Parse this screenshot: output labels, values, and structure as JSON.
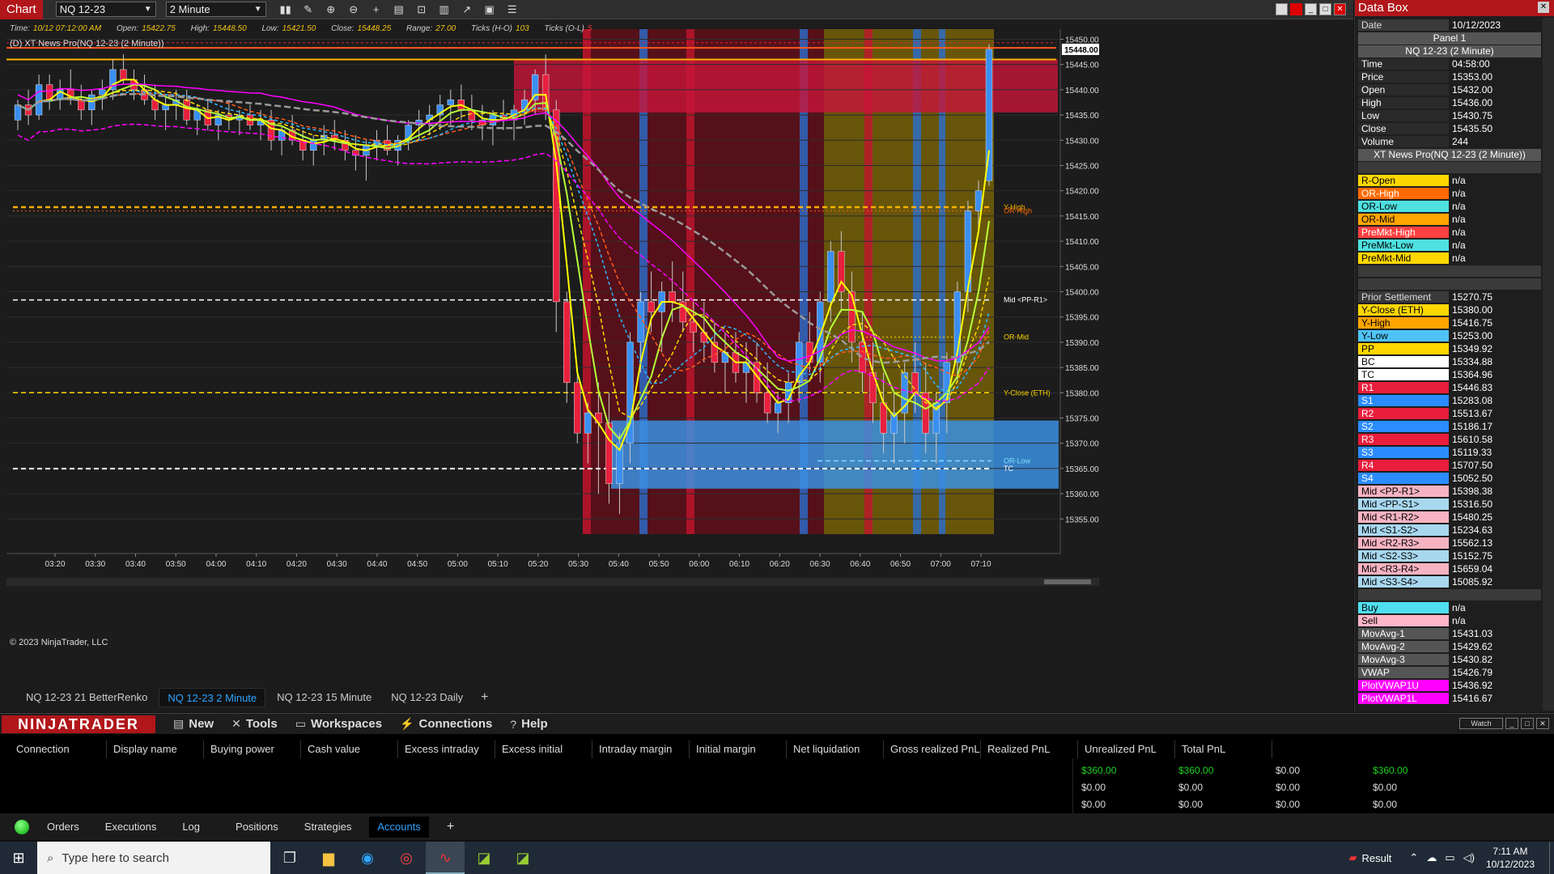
{
  "toolbar": {
    "title": "Chart",
    "instrument": "NQ 12-23",
    "interval": "2 Minute"
  },
  "info": {
    "time_label": "Time:",
    "time": "10/12 07:12:00 AM",
    "open_label": "Open:",
    "open": "15422.75",
    "high_label": "High:",
    "high": "15448.50",
    "low_label": "Low:",
    "low": "15421.50",
    "close_label": "Close:",
    "close": "15448.25",
    "range_label": "Range:",
    "range": "27.00",
    "ticks_ho_label": "Ticks (H-O)",
    "ticks_ho": "103",
    "ticks_ol_label": "Ticks (O-L)",
    "ticks_ol": "5"
  },
  "indicator_label": "(D) XT News Pro(NQ 12-23 (2 Minute))",
  "copyright": "© 2023 NinjaTrader, LLC",
  "chart_data": {
    "type": "candlestick",
    "instrument": "NQ 12-23",
    "interval": "2 Minute",
    "last_price": "15448.00",
    "ylim": [
      15352,
      15452
    ],
    "y_ticks": [
      15355,
      15360,
      15365,
      15370,
      15375,
      15380,
      15385,
      15390,
      15395,
      15400,
      15405,
      15410,
      15415,
      15420,
      15425,
      15430,
      15435,
      15440,
      15445,
      15450
    ],
    "y_tick_labels": [
      "15355.00",
      "15360.00",
      "15365.00",
      "15370.00",
      "15375.00",
      "15380.00",
      "15385.00",
      "15390.00",
      "15395.00",
      "15400.00",
      "15405.00",
      "15410.00",
      "15415.00",
      "15420.00",
      "15425.00",
      "15430.00",
      "15435.00",
      "15440.00",
      "15445.00",
      "15450.00"
    ],
    "x_tick_labels": [
      "03:20",
      "03:30",
      "03:40",
      "03:50",
      "04:00",
      "04:10",
      "04:20",
      "04:30",
      "04:40",
      "04:50",
      "05:00",
      "05:10",
      "05:20",
      "05:30",
      "05:40",
      "05:50",
      "06:00",
      "06:10",
      "06:20",
      "06:30",
      "06:40",
      "06:50",
      "07:00",
      "07:10"
    ],
    "level_lines": [
      {
        "name": "Y-High",
        "value": 15416.75,
        "color": "#ffb000"
      },
      {
        "name": "OR-High",
        "value": 15416.0,
        "color": "#ff6a00"
      },
      {
        "name": "Mid <PP-R1>",
        "value": 15398.38,
        "color": "#ffffff"
      },
      {
        "name": "OR-Mid",
        "value": 15391.0,
        "color": "#ffd700"
      },
      {
        "name": "Y-Close (ETH)",
        "value": 15380.0,
        "color": "#ffd700"
      },
      {
        "name": "OR-Low",
        "value": 15366.5,
        "color": "#7ee0ff"
      },
      {
        "name": "TC",
        "value": 15364.96,
        "color": "#ffffff"
      }
    ],
    "candles": [
      [
        15434,
        15438,
        15432,
        15437
      ],
      [
        15437,
        15440,
        15433,
        15435
      ],
      [
        15435,
        15443,
        15434,
        15441
      ],
      [
        15441,
        15443,
        15436,
        15438
      ],
      [
        15438,
        15442,
        15436,
        15440
      ],
      [
        15440,
        15444,
        15437,
        15438
      ],
      [
        15438,
        15441,
        15434,
        15436
      ],
      [
        15436,
        15440,
        15433,
        15439
      ],
      [
        15439,
        15442,
        15436,
        15440
      ],
      [
        15440,
        15446,
        15438,
        15444
      ],
      [
        15444,
        15447,
        15441,
        15442
      ],
      [
        15442,
        15444,
        15438,
        15440
      ],
      [
        15440,
        15443,
        15437,
        15438
      ],
      [
        15438,
        15441,
        15434,
        15436
      ],
      [
        15436,
        15439,
        15432,
        15437
      ],
      [
        15437,
        15440,
        15434,
        15438
      ],
      [
        15438,
        15440,
        15433,
        15434
      ],
      [
        15434,
        15437,
        15431,
        15436
      ],
      [
        15436,
        15438,
        15432,
        15433
      ],
      [
        15433,
        15436,
        15430,
        15435
      ],
      [
        15435,
        15438,
        15432,
        15434
      ],
      [
        15434,
        15436,
        15431,
        15435
      ],
      [
        15435,
        15437,
        15432,
        15433
      ],
      [
        15433,
        15436,
        15430,
        15434
      ],
      [
        15434,
        15436,
        15428,
        15430
      ],
      [
        15430,
        15433,
        15427,
        15432
      ],
      [
        15432,
        15435,
        15429,
        15430
      ],
      [
        15430,
        15432,
        15426,
        15428
      ],
      [
        15428,
        15431,
        15425,
        15430
      ],
      [
        15430,
        15433,
        15427,
        15431
      ],
      [
        15431,
        15434,
        15428,
        15430
      ],
      [
        15430,
        15432,
        15426,
        15428
      ],
      [
        15428,
        15431,
        15424,
        15427
      ],
      [
        15427,
        15430,
        15422,
        15429
      ],
      [
        15429,
        15432,
        15426,
        15430
      ],
      [
        15430,
        15433,
        15427,
        15428
      ],
      [
        15428,
        15431,
        15425,
        15430
      ],
      [
        15430,
        15434,
        15428,
        15433
      ],
      [
        15433,
        15436,
        15430,
        15434
      ],
      [
        15434,
        15437,
        15431,
        15435
      ],
      [
        15435,
        15439,
        15432,
        15437
      ],
      [
        15437,
        15440,
        15433,
        15438
      ],
      [
        15438,
        15441,
        15434,
        15436
      ],
      [
        15436,
        15439,
        15432,
        15434
      ],
      [
        15434,
        15437,
        15430,
        15433
      ],
      [
        15433,
        15436,
        15429,
        15435
      ],
      [
        15435,
        15438,
        15432,
        15434
      ],
      [
        15434,
        15437,
        15430,
        15436
      ],
      [
        15436,
        15440,
        15433,
        15438
      ],
      [
        15438,
        15444,
        15435,
        15443
      ],
      [
        15443,
        15447,
        15434,
        15436
      ],
      [
        15436,
        15438,
        15392,
        15398
      ],
      [
        15398,
        15400,
        15378,
        15382
      ],
      [
        15382,
        15385,
        15370,
        15372
      ],
      [
        15372,
        15378,
        15366,
        15376
      ],
      [
        15376,
        15382,
        15360,
        15374
      ],
      [
        15374,
        15380,
        15358,
        15362
      ],
      [
        15362,
        15372,
        15356,
        15370
      ],
      [
        15370,
        15392,
        15366,
        15390
      ],
      [
        15390,
        15400,
        15384,
        15398
      ],
      [
        15398,
        15404,
        15392,
        15396
      ],
      [
        15396,
        15402,
        15388,
        15400
      ],
      [
        15400,
        15406,
        15394,
        15398
      ],
      [
        15398,
        15404,
        15392,
        15394
      ],
      [
        15394,
        15398,
        15388,
        15392
      ],
      [
        15392,
        15398,
        15386,
        15390
      ],
      [
        15390,
        15394,
        15384,
        15386
      ],
      [
        15386,
        15392,
        15380,
        15388
      ],
      [
        15388,
        15392,
        15382,
        15384
      ],
      [
        15384,
        15390,
        15378,
        15386
      ],
      [
        15386,
        15390,
        15378,
        15380
      ],
      [
        15380,
        15386,
        15374,
        15376
      ],
      [
        15376,
        15380,
        15372,
        15378
      ],
      [
        15378,
        15384,
        15374,
        15382
      ],
      [
        15382,
        15392,
        15378,
        15390
      ],
      [
        15390,
        15396,
        15384,
        15386
      ],
      [
        15386,
        15400,
        15382,
        15398
      ],
      [
        15398,
        15410,
        15394,
        15408
      ],
      [
        15408,
        15412,
        15396,
        15400
      ],
      [
        15400,
        15404,
        15386,
        15390
      ],
      [
        15390,
        15396,
        15380,
        15384
      ],
      [
        15384,
        15390,
        15374,
        15378
      ],
      [
        15378,
        15384,
        15368,
        15372
      ],
      [
        15372,
        15380,
        15366,
        15376
      ],
      [
        15376,
        15386,
        15370,
        15384
      ],
      [
        15384,
        15390,
        15376,
        15380
      ],
      [
        15380,
        15386,
        15368,
        15372
      ],
      [
        15372,
        15380,
        15366,
        15378
      ],
      [
        15378,
        15388,
        15372,
        15386
      ],
      [
        15386,
        15402,
        15382,
        15400
      ],
      [
        15400,
        15418,
        15396,
        15416
      ],
      [
        15416,
        15422,
        15412,
        15420
      ],
      [
        15422,
        15449,
        15421,
        15448
      ]
    ]
  },
  "chart_tabs": [
    "NQ 12-23 21 BetterRenko",
    "NQ 12-23 2 Minute",
    "NQ 12-23 15 Minute",
    "NQ 12-23 Daily"
  ],
  "data_box": {
    "title": "Data Box",
    "date_label": "Date",
    "date": "10/12/2023",
    "panel": "Panel 1",
    "series": "NQ 12-23 (2 Minute)",
    "ohlc": [
      {
        "label": "Time",
        "value": "04:58:00"
      },
      {
        "label": "Price",
        "value": "15353.00"
      },
      {
        "label": "Open",
        "value": "15432.00"
      },
      {
        "label": "High",
        "value": "15436.00"
      },
      {
        "label": "Low",
        "value": "15430.75"
      },
      {
        "label": "Close",
        "value": "15435.50"
      },
      {
        "label": "Volume",
        "value": "244"
      }
    ],
    "indicator": "XT News Pro(NQ 12-23 (2 Minute))",
    "or_rows": [
      {
        "label": "R-Open",
        "value": "n/a",
        "color": "#ffd700",
        "text": "#000"
      },
      {
        "label": "OR-High",
        "value": "n/a",
        "color": "#ff6a00",
        "text": "#fff"
      },
      {
        "label": "OR-Low",
        "value": "n/a",
        "color": "#4fe0e0",
        "text": "#000"
      },
      {
        "label": "OR-Mid",
        "value": "n/a",
        "color": "#ffa500",
        "text": "#000"
      },
      {
        "label": "PreMkt-High",
        "value": "n/a",
        "color": "#ff4040",
        "text": "#fff"
      },
      {
        "label": "PreMkt-Low",
        "value": "n/a",
        "color": "#4fe0e0",
        "text": "#000"
      },
      {
        "label": "PreMkt-Mid",
        "value": "n/a",
        "color": "#ffd700",
        "text": "#000"
      }
    ],
    "pivot_rows": [
      {
        "label": "Prior Settlement",
        "value": "15270.75",
        "color": "#3a3a3a",
        "text": "#ddd"
      },
      {
        "label": "Y-Close (ETH)",
        "value": "15380.00",
        "color": "#ffd700",
        "text": "#000"
      },
      {
        "label": "Y-High",
        "value": "15416.75",
        "color": "#ffa500",
        "text": "#000"
      },
      {
        "label": "Y-Low",
        "value": "15253.00",
        "color": "#4fc3f7",
        "text": "#000"
      },
      {
        "label": "PP",
        "value": "15349.92",
        "color": "#ffd700",
        "text": "#000"
      },
      {
        "label": "BC",
        "value": "15334.88",
        "color": "#ffffff",
        "text": "#000"
      },
      {
        "label": "TC",
        "value": "15364.96",
        "color": "#ffffff",
        "text": "#000"
      },
      {
        "label": "R1",
        "value": "15446.83",
        "color": "#e81e3c",
        "text": "#fff"
      },
      {
        "label": "S1",
        "value": "15283.08",
        "color": "#2b8cff",
        "text": "#fff"
      },
      {
        "label": "R2",
        "value": "15513.67",
        "color": "#e81e3c",
        "text": "#fff"
      },
      {
        "label": "S2",
        "value": "15186.17",
        "color": "#2b8cff",
        "text": "#fff"
      },
      {
        "label": "R3",
        "value": "15610.58",
        "color": "#e81e3c",
        "text": "#fff"
      },
      {
        "label": "S3",
        "value": "15119.33",
        "color": "#2b8cff",
        "text": "#fff"
      },
      {
        "label": "R4",
        "value": "15707.50",
        "color": "#e81e3c",
        "text": "#fff"
      },
      {
        "label": "S4",
        "value": "15052.50",
        "color": "#2b8cff",
        "text": "#fff"
      },
      {
        "label": "Mid <PP-R1>",
        "value": "15398.38",
        "color": "#f7b3c2",
        "text": "#000"
      },
      {
        "label": "Mid <PP-S1>",
        "value": "15316.50",
        "color": "#a8d8f0",
        "text": "#000"
      },
      {
        "label": "Mid <R1-R2>",
        "value": "15480.25",
        "color": "#f7b3c2",
        "text": "#000"
      },
      {
        "label": "Mid <S1-S2>",
        "value": "15234.63",
        "color": "#a8d8f0",
        "text": "#000"
      },
      {
        "label": "Mid <R2-R3>",
        "value": "15562.13",
        "color": "#f7b3c2",
        "text": "#000"
      },
      {
        "label": "Mid <S2-S3>",
        "value": "15152.75",
        "color": "#a8d8f0",
        "text": "#000"
      },
      {
        "label": "Mid <R3-R4>",
        "value": "15659.04",
        "color": "#f7b3c2",
        "text": "#000"
      },
      {
        "label": "Mid <S3-S4>",
        "value": "15085.92",
        "color": "#a8d8f0",
        "text": "#000"
      }
    ],
    "other_rows": [
      {
        "label": "Buy",
        "value": "n/a",
        "color": "#4fe0f0",
        "text": "#000"
      },
      {
        "label": "Sell",
        "value": "n/a",
        "color": "#ffb6c8",
        "text": "#000"
      },
      {
        "label": "MovAvg-1",
        "value": "15431.03",
        "color": "#555",
        "text": "#fff"
      },
      {
        "label": "MovAvg-2",
        "value": "15429.62",
        "color": "#555",
        "text": "#fff"
      },
      {
        "label": "MovAvg-3",
        "value": "15430.82",
        "color": "#555",
        "text": "#fff"
      },
      {
        "label": "VWAP",
        "value": "15426.79",
        "color": "#555",
        "text": "#fff"
      },
      {
        "label": "PlotVWAP1U",
        "value": "15436.92",
        "color": "#ff00ff",
        "text": "#fff"
      },
      {
        "label": "PlotVWAP1L",
        "value": "15416.67",
        "color": "#ff00ff",
        "text": "#fff"
      }
    ]
  },
  "control_center": {
    "logo": "NINJATRADER",
    "menus": [
      {
        "icon": "▤",
        "label": "New"
      },
      {
        "icon": "✕",
        "label": "Tools"
      },
      {
        "icon": "▭",
        "label": "Workspaces"
      },
      {
        "icon": "⚡",
        "label": "Connections"
      },
      {
        "icon": "?",
        "label": "Help"
      }
    ],
    "watch": "Watch",
    "columns": [
      "Connection",
      "Display name",
      "Buying power",
      "Cash value",
      "Excess intraday margin",
      "Excess initial margin",
      "Intraday margin",
      "Initial margin",
      "Net liquidation",
      "Gross realized PnL",
      "Realized PnL",
      "Unrealized PnL",
      "Total PnL"
    ],
    "pnl_rows": [
      [
        "$360.00",
        "$360.00",
        "$0.00",
        "$360.00"
      ],
      [
        "$0.00",
        "$0.00",
        "$0.00",
        "$0.00"
      ],
      [
        "$0.00",
        "$0.00",
        "$0.00",
        "$0.00"
      ]
    ],
    "tabs": [
      "Orders",
      "Executions",
      "Log",
      "Positions",
      "Strategies",
      "Accounts"
    ]
  },
  "taskbar": {
    "search_placeholder": "Type here to search",
    "tray_label": "Result",
    "time": "7:11 AM",
    "date": "10/12/2023"
  }
}
